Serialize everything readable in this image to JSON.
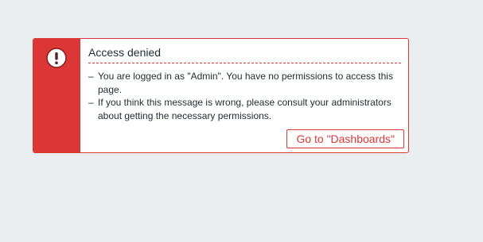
{
  "alert": {
    "title": "Access denied",
    "messages": [
      "You are logged in as \"Admin\". You have no permissions to access this page.",
      "If you think this message is wrong, please consult your administrators about getting the necessary permissions."
    ],
    "button_label": "Go to \"Dashboards\"",
    "icon": "exclamation-icon",
    "colors": {
      "accent": "#dc3737",
      "background": "#ebeef0",
      "text": "#1f2c33"
    }
  }
}
